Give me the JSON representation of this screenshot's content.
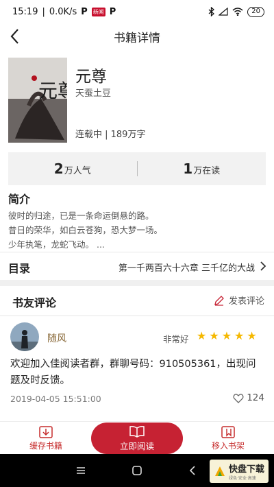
{
  "statusbar": {
    "time": "15:19",
    "speed": "0.0K/s",
    "p_icon": "P",
    "news_icon": "新闻",
    "battery": "20"
  },
  "header": {
    "title": "书籍详情"
  },
  "book": {
    "title": "元尊",
    "author": "天蚕土豆",
    "status": "连载中 | 189万字",
    "cover_text": "元尊"
  },
  "stats": {
    "popularity_num": "2",
    "popularity_label": "万人气",
    "reading_num": "1",
    "reading_label": "万在读"
  },
  "intro": {
    "heading": "简介",
    "lines": [
      "彼时的归途，已是一条命运倒悬的路。",
      "昔日的荣华，如白云苍狗，恐大梦一场。",
      "少年执笔，龙蛇飞动。 ..."
    ]
  },
  "catalog": {
    "label": "目录",
    "latest": "第一千两百六十六章 三千亿的大战"
  },
  "reviews": {
    "heading": "书友评论",
    "write_label": "发表评论",
    "items": [
      {
        "user": "随风",
        "rating_text": "非常好",
        "stars": 5,
        "text": "欢迎加入佳阅读者群，群聊号码：910505361，出现问题及时反馈。",
        "time": "2019-04-05 15:51:00",
        "likes": "124"
      }
    ]
  },
  "bottombar": {
    "cache_label": "缓存书籍",
    "read_label": "立即阅读",
    "shelf_label": "移入书架"
  },
  "watermark": {
    "main": "快盘下载",
    "sub": "绿色·安全·高速"
  },
  "colors": {
    "accent": "#c62233",
    "star": "#f5b800"
  }
}
